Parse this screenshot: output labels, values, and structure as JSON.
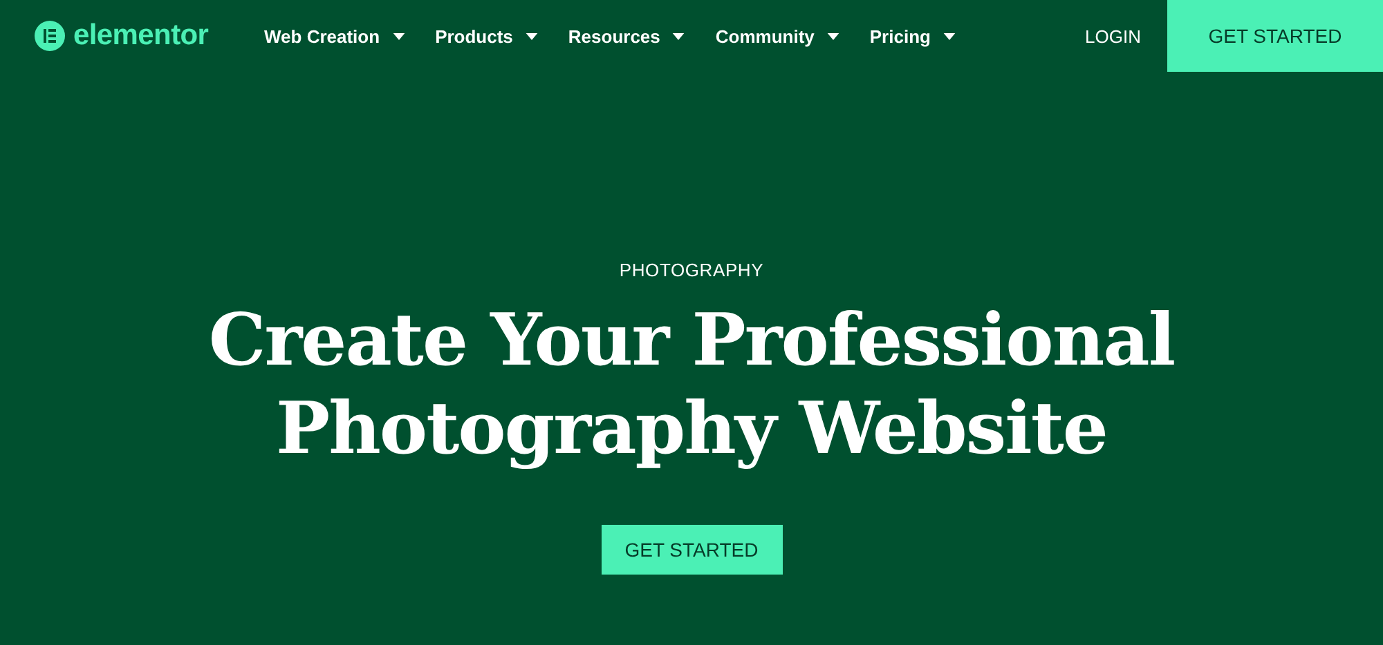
{
  "header": {
    "logo": "elementor",
    "nav": [
      {
        "label": "Web Creation"
      },
      {
        "label": "Products"
      },
      {
        "label": "Resources"
      },
      {
        "label": "Community"
      },
      {
        "label": "Pricing"
      }
    ],
    "login": "LOGIN",
    "cta": "GET STARTED"
  },
  "hero": {
    "eyebrow": "PHOTOGRAPHY",
    "title_lines": [
      "Create Your Professional",
      "Photography Website"
    ],
    "cta": "GET STARTED"
  }
}
